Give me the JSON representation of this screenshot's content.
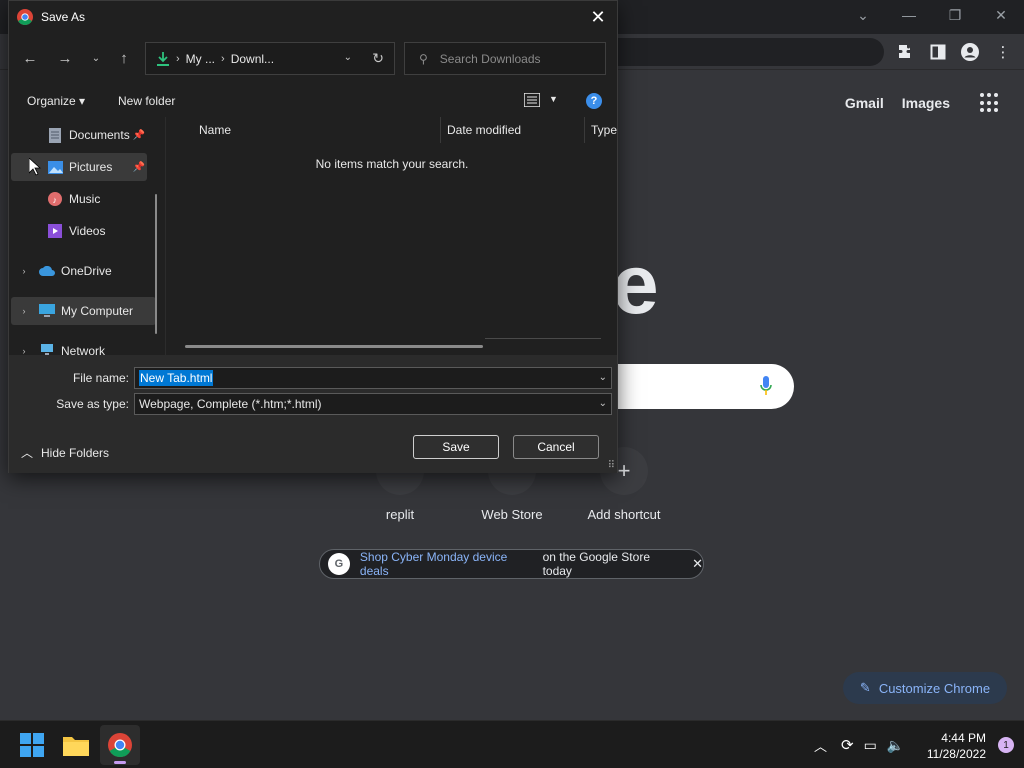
{
  "browser": {
    "ntp_links": [
      "Gmail",
      "Images"
    ],
    "logo_partial": "e",
    "shortcuts": [
      {
        "label": "replit"
      },
      {
        "label": "Web Store"
      },
      {
        "label": "Add shortcut"
      }
    ],
    "promo": {
      "link_text": "Shop Cyber Monday device deals",
      "rest_text": "on the Google Store today"
    },
    "customize_label": "Customize Chrome"
  },
  "dialog": {
    "title": "Save As",
    "address": {
      "crumb1": "My ...",
      "crumb2": "Downl..."
    },
    "search_placeholder": "Search Downloads",
    "toolbar": {
      "organize": "Organize",
      "new_folder": "New folder"
    },
    "nav_items": [
      {
        "label": "Documents",
        "icon": "documents-icon",
        "pinned": true
      },
      {
        "label": "Pictures",
        "icon": "pictures-icon",
        "pinned": true,
        "selected": true
      },
      {
        "label": "Music",
        "icon": "music-icon"
      },
      {
        "label": "Videos",
        "icon": "videos-icon"
      },
      {
        "label": "OneDrive",
        "icon": "onedrive-icon",
        "expandable": true
      },
      {
        "label": "My Computer",
        "icon": "computer-icon",
        "expandable": true
      },
      {
        "label": "Network",
        "icon": "network-icon",
        "expandable": true
      }
    ],
    "columns": [
      "Name",
      "Date modified",
      "Type"
    ],
    "empty_message": "No items match your search.",
    "file_name_label": "File name:",
    "file_name_value": "New Tab.html",
    "save_type_label": "Save as type:",
    "save_type_value": "Webpage, Complete (*.htm;*.html)",
    "hide_folders": "Hide Folders",
    "save_button": "Save",
    "cancel_button": "Cancel"
  },
  "taskbar": {
    "time": "4:44 PM",
    "date": "11/28/2022",
    "notification_count": "1"
  },
  "colors": {
    "accent_blue": "#0078d4",
    "link_blue": "#8ab4f8",
    "dialog_bg": "#202020"
  }
}
